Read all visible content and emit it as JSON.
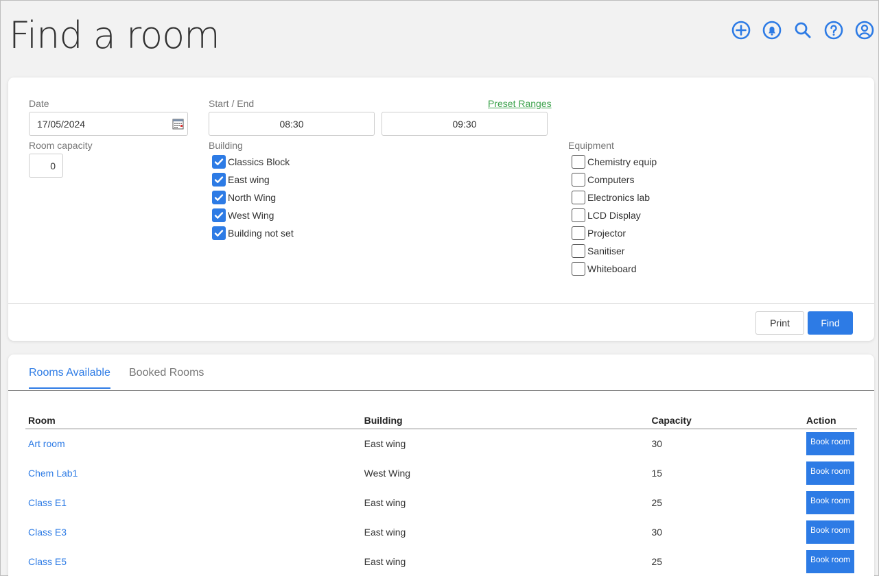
{
  "page": {
    "title": "Find a room"
  },
  "top_icons": [
    {
      "name": "add-icon"
    },
    {
      "name": "bell-icon"
    },
    {
      "name": "search-icon"
    },
    {
      "name": "help-icon"
    },
    {
      "name": "user-icon"
    }
  ],
  "filters": {
    "date_label": "Date",
    "date_value": "17/05/2024",
    "start_end_label": "Start / End",
    "preset_ranges": "Preset Ranges",
    "start_value": "08:30",
    "end_value": "09:30",
    "capacity_label": "Room capacity",
    "capacity_value": "0",
    "building_label": "Building",
    "buildings": [
      {
        "label": "Classics Block",
        "checked": true
      },
      {
        "label": "East wing",
        "checked": true
      },
      {
        "label": "North Wing",
        "checked": true
      },
      {
        "label": "West Wing",
        "checked": true
      },
      {
        "label": "Building not set",
        "checked": true
      }
    ],
    "equipment_label": "Equipment",
    "equipment": [
      {
        "label": "Chemistry equip",
        "checked": false
      },
      {
        "label": "Computers",
        "checked": false
      },
      {
        "label": "Electronics lab",
        "checked": false
      },
      {
        "label": "LCD Display",
        "checked": false
      },
      {
        "label": "Projector",
        "checked": false
      },
      {
        "label": "Sanitiser",
        "checked": false
      },
      {
        "label": "Whiteboard",
        "checked": false
      }
    ],
    "print_label": "Print",
    "find_label": "Find"
  },
  "tabs": [
    {
      "label": "Rooms Available",
      "active": true
    },
    {
      "label": "Booked Rooms",
      "active": false
    }
  ],
  "table": {
    "headers": {
      "room": "Room",
      "building": "Building",
      "capacity": "Capacity",
      "action": "Action"
    },
    "book_label": "Book room",
    "rows": [
      {
        "room": "Art room",
        "building": "East wing",
        "capacity": "30"
      },
      {
        "room": "Chem Lab1",
        "building": "West Wing",
        "capacity": "15"
      },
      {
        "room": "Class E1",
        "building": "East wing",
        "capacity": "25"
      },
      {
        "room": "Class E3",
        "building": "East wing",
        "capacity": "30"
      },
      {
        "room": "Class E5",
        "building": "East wing",
        "capacity": "25"
      }
    ]
  },
  "colors": {
    "accent": "#2d7be5",
    "link_green": "#3aa14a"
  }
}
